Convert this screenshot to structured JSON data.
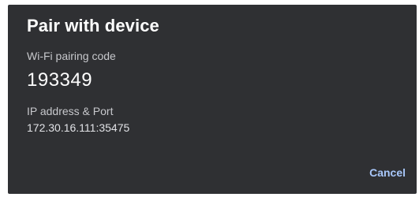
{
  "dialog": {
    "title": "Pair with device",
    "pairing_code_label": "Wi-Fi pairing code",
    "pairing_code": "193349",
    "ip_label": "IP address & Port",
    "ip_value": "172.30.16.111:35475",
    "cancel_label": "Cancel"
  },
  "colors": {
    "background": "#2f3033",
    "accent": "#a8c7fa"
  }
}
